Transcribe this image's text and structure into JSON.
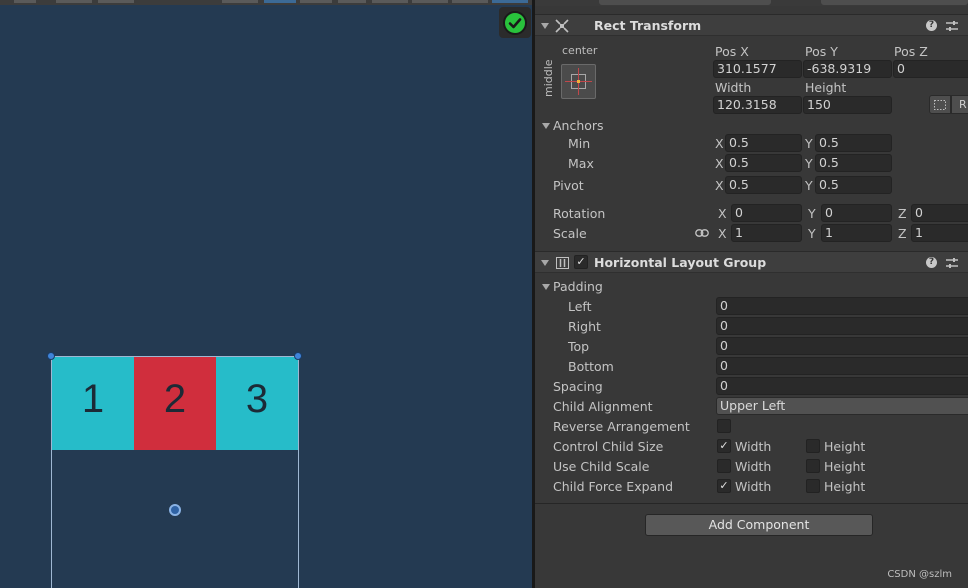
{
  "scene": {
    "cells": [
      {
        "label": "1",
        "color": "#26bcc9"
      },
      {
        "label": "2",
        "color": "#d02e3d"
      },
      {
        "label": "3",
        "color": "#26bcc9"
      }
    ]
  },
  "rect_transform": {
    "title": "Rect Transform",
    "anchor_h": "center",
    "anchor_v": "middle",
    "pos_x_label": "Pos X",
    "pos_y_label": "Pos Y",
    "pos_z_label": "Pos Z",
    "pos_x": "310.1577",
    "pos_y": "-638.9319",
    "pos_z": "0",
    "width_label": "Width",
    "height_label": "Height",
    "width": "120.3158",
    "height": "150",
    "r_button": "R",
    "anchors_label": "Anchors",
    "min_label": "Min",
    "max_label": "Max",
    "x": "X",
    "y": "Y",
    "z": "Z",
    "min_x": "0.5",
    "min_y": "0.5",
    "max_x": "0.5",
    "max_y": "0.5",
    "pivot_label": "Pivot",
    "pivot_x": "0.5",
    "pivot_y": "0.5",
    "rotation_label": "Rotation",
    "rot_x": "0",
    "rot_y": "0",
    "rot_z": "0",
    "scale_label": "Scale",
    "scale_x": "1",
    "scale_y": "1",
    "scale_z": "1"
  },
  "hlg": {
    "title": "Horizontal Layout Group",
    "padding_label": "Padding",
    "left_label": "Left",
    "left": "0",
    "right_label": "Right",
    "right": "0",
    "top_label": "Top",
    "top": "0",
    "bottom_label": "Bottom",
    "bottom": "0",
    "spacing_label": "Spacing",
    "spacing": "0",
    "child_alignment_label": "Child Alignment",
    "child_alignment": "Upper Left",
    "reverse_label": "Reverse Arrangement",
    "control_size_label": "Control Child Size",
    "use_scale_label": "Use Child Scale",
    "force_expand_label": "Child Force Expand",
    "width_opt": "Width",
    "height_opt": "Height",
    "checkmark": "✓"
  },
  "add_component": "Add Component",
  "watermark": "CSDN @szlm"
}
